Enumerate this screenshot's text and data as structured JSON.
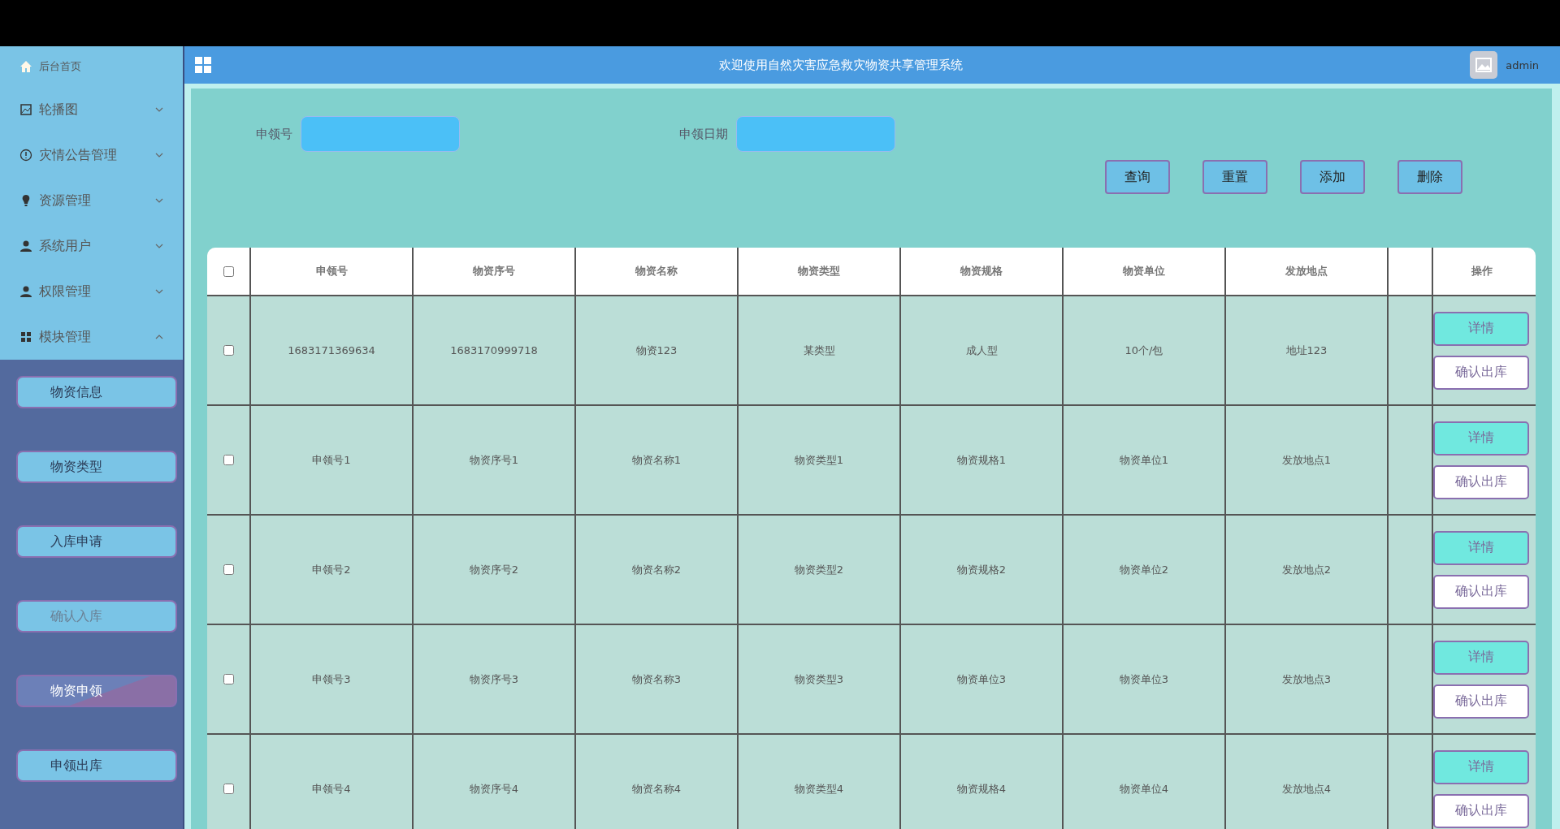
{
  "sidebar": {
    "home": {
      "label": "后台首页"
    },
    "items": [
      {
        "label": "轮播图",
        "kind": "image",
        "expanded": false
      },
      {
        "label": "灾情公告管理",
        "kind": "info",
        "expanded": false
      },
      {
        "label": "资源管理",
        "kind": "bulb",
        "expanded": false
      },
      {
        "label": "系统用户",
        "kind": "user",
        "expanded": false
      },
      {
        "label": "权限管理",
        "kind": "user",
        "expanded": false
      },
      {
        "label": "模块管理",
        "kind": "grid",
        "expanded": true,
        "children": [
          {
            "label": "物资信息",
            "selected": false,
            "muted": false
          },
          {
            "label": "物资类型",
            "selected": false,
            "muted": false
          },
          {
            "label": "入库申请",
            "selected": false,
            "muted": false
          },
          {
            "label": "确认入库",
            "selected": false,
            "muted": true
          },
          {
            "label": "物资申领",
            "selected": true,
            "muted": false
          },
          {
            "label": "申领出库",
            "selected": false,
            "muted": false
          }
        ]
      }
    ]
  },
  "header": {
    "title": "欢迎使用自然灾害应急救灾物资共享管理系统",
    "user": "admin"
  },
  "search": {
    "fields": [
      {
        "label": "申领号"
      },
      {
        "label": "申领日期"
      }
    ],
    "buttons": [
      "查询",
      "重置",
      "添加",
      "删除"
    ]
  },
  "table": {
    "columns": [
      "申领号",
      "物资序号",
      "物资名称",
      "物资类型",
      "物资规格",
      "物资单位",
      "发放地点",
      "",
      "操作"
    ],
    "select_all": {
      "checked": false
    },
    "rows": [
      {
        "checked": false,
        "cells": [
          "1683171369634",
          "1683170999718",
          "物资123",
          "某类型",
          "成人型",
          "10个/包",
          "地址123"
        ],
        "actions": [
          "详情",
          "确认出库"
        ]
      },
      {
        "checked": false,
        "cells": [
          "申领号1",
          "物资序号1",
          "物资名称1",
          "物资类型1",
          "物资规格1",
          "物资单位1",
          "发放地点1"
        ],
        "actions": [
          "详情",
          "确认出库"
        ]
      },
      {
        "checked": false,
        "cells": [
          "申领号2",
          "物资序号2",
          "物资名称2",
          "物资类型2",
          "物资规格2",
          "物资单位2",
          "发放地点2"
        ],
        "actions": [
          "详情",
          "确认出库"
        ]
      },
      {
        "checked": false,
        "cells": [
          "申领号3",
          "物资序号3",
          "物资名称3",
          "物资类型3",
          "物资单位3",
          "物资单位3",
          "发放地点3"
        ],
        "actions": [
          "详情",
          "确认出库"
        ]
      },
      {
        "checked": false,
        "cells": [
          "申领号4",
          "物资序号4",
          "物资名称4",
          "物资类型4",
          "物资规格4",
          "物资单位4",
          "发放地点4"
        ],
        "actions": [
          "详情",
          "确认出库"
        ]
      }
    ]
  }
}
